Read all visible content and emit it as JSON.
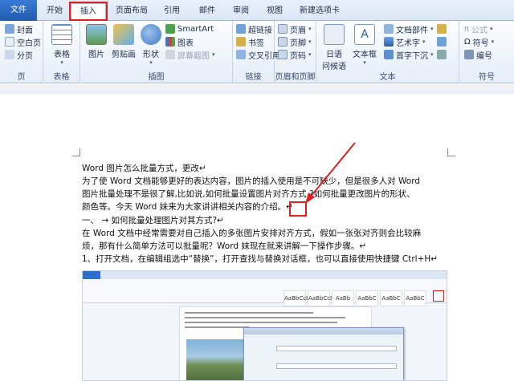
{
  "tabs": [
    "文件",
    "开始",
    "插入",
    "页面布局",
    "引用",
    "邮件",
    "审阅",
    "视图",
    "新建选项卡"
  ],
  "ribbon": {
    "pages": {
      "label": "页",
      "items": [
        "封面",
        "空白页",
        "分页"
      ]
    },
    "tables": {
      "label": "表格",
      "btn": "表格"
    },
    "illustrations": {
      "label": "插图",
      "picture": "图片",
      "clipart": "剪贴画",
      "shapes": "形状",
      "smartart": "SmartArt",
      "chart": "图表",
      "screenshot": "屏幕截图"
    },
    "links": {
      "label": "链接",
      "items": [
        "超链接",
        "书签",
        "交叉引用"
      ]
    },
    "headerfooter": {
      "label": "页眉和页脚",
      "items": [
        "页眉",
        "页脚",
        "页码"
      ]
    },
    "text": {
      "label": "文本",
      "date": "日语",
      "date2": "问候语",
      "textbox": "文本框",
      "parts": "文档部件",
      "wordart": "艺术字",
      "dropcap": "首字下沉"
    },
    "symbols": {
      "label": "符号",
      "items": [
        "公式",
        "符号",
        "编号"
      ]
    }
  },
  "doc": {
    "lines": [
      "Word 图片怎么批量方式，更改↵",
      "为了使 Word 文档能够更好的表达内容，图片的插入使用是不可缺少，但是很多人对 Word",
      "图片批量处理不是很了解,比如说,如何批量设置图片对齐方式,?如何批量更改图片的形状、",
      "颜色等。今天 Word 妹来为大家讲讲相关内容的介绍。↵",
      "一、  →  如何批量处理图片对其方式?↵",
      "在 Word 文档中经常需要对自己插入的多张图片安排对齐方式，假如一张张对齐则会比较麻",
      "烦，那有什么简单方法可以批量呢？Word 妹现在就来讲解一下操作步骤。↵",
      "1、打开文档，在编辑组选中“替换”，打开查找与替换对话框，也可以直接使用快捷键 Ctrl+H↵"
    ]
  },
  "embed": {
    "styles": [
      "AaBbCcDc",
      "AaBbCcDc",
      "AaBb",
      "AaBbC",
      "AaBbC",
      "AaBbC"
    ]
  }
}
